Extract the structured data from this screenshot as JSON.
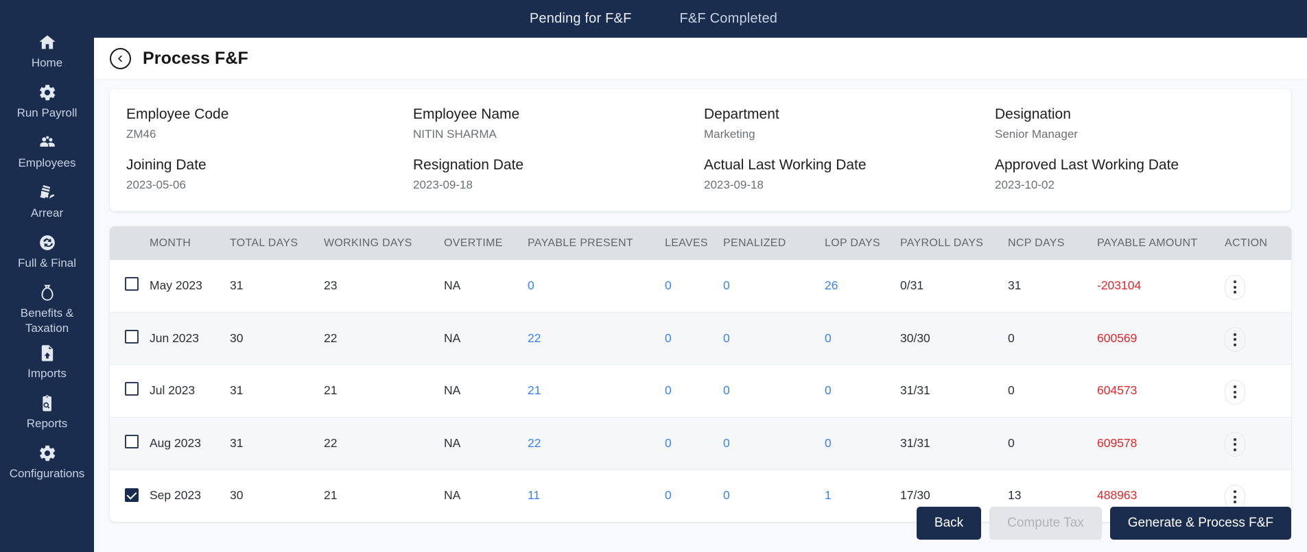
{
  "topbar": {
    "tabs": [
      {
        "label": "Pending for F&F",
        "active": true
      },
      {
        "label": "F&F Completed",
        "active": false
      }
    ]
  },
  "sidebar": {
    "items": [
      {
        "label": "Home",
        "icon": "home-icon"
      },
      {
        "label": "Run Payroll",
        "icon": "gear-icon"
      },
      {
        "label": "Employees",
        "icon": "people-icon"
      },
      {
        "label": "Arrear",
        "icon": "money-hand-icon"
      },
      {
        "label": "Full & Final",
        "icon": "refresh-circle-icon"
      },
      {
        "label": "Benefits &\nTaxation",
        "icon": "money-bag-icon"
      },
      {
        "label": "Imports",
        "icon": "file-upload-icon"
      },
      {
        "label": "Reports",
        "icon": "clipboard-search-icon"
      },
      {
        "label": "Configurations",
        "icon": "gear-icon"
      }
    ],
    "active_label": "Full & Final"
  },
  "header": {
    "title": "Process F&F",
    "back_icon": "back-arrow-circle-icon"
  },
  "employee": {
    "fields": [
      {
        "label": "Employee Code",
        "value": "ZM46"
      },
      {
        "label": "Employee Name",
        "value": "NITIN SHARMA"
      },
      {
        "label": "Department",
        "value": "Marketing"
      },
      {
        "label": "Designation",
        "value": "Senior Manager"
      },
      {
        "label": "Joining Date",
        "value": "2023-05-06"
      },
      {
        "label": "Resignation Date",
        "value": "2023-09-18"
      },
      {
        "label": "Actual Last Working Date",
        "value": "2023-09-18"
      },
      {
        "label": "Approved Last Working Date",
        "value": "2023-10-02"
      }
    ]
  },
  "table": {
    "columns": [
      "MONTH",
      "TOTAL DAYS",
      "WORKING DAYS",
      "OVERTIME",
      "PAYABLE PRESENT",
      "LEAVES",
      "PENALIZED",
      "LOP DAYS",
      "PAYROLL DAYS",
      "NCP DAYS",
      "PAYABLE AMOUNT",
      "ACTION"
    ],
    "rows": [
      {
        "selected": false,
        "month": "May 2023",
        "total_days": "31",
        "working_days": "23",
        "overtime": "NA",
        "payable_present": "0",
        "leaves": "0",
        "penalized": "0",
        "lop_days": "26",
        "payroll_days": "0/31",
        "ncp_days": "31",
        "payable_amount": "-203104"
      },
      {
        "selected": false,
        "month": "Jun 2023",
        "total_days": "30",
        "working_days": "22",
        "overtime": "NA",
        "payable_present": "22",
        "leaves": "0",
        "penalized": "0",
        "lop_days": "0",
        "payroll_days": "30/30",
        "ncp_days": "0",
        "payable_amount": "600569"
      },
      {
        "selected": false,
        "month": "Jul 2023",
        "total_days": "31",
        "working_days": "21",
        "overtime": "NA",
        "payable_present": "21",
        "leaves": "0",
        "penalized": "0",
        "lop_days": "0",
        "payroll_days": "31/31",
        "ncp_days": "0",
        "payable_amount": "604573"
      },
      {
        "selected": false,
        "month": "Aug 2023",
        "total_days": "31",
        "working_days": "22",
        "overtime": "NA",
        "payable_present": "22",
        "leaves": "0",
        "penalized": "0",
        "lop_days": "0",
        "payroll_days": "31/31",
        "ncp_days": "0",
        "payable_amount": "609578"
      },
      {
        "selected": true,
        "month": "Sep 2023",
        "total_days": "30",
        "working_days": "21",
        "overtime": "NA",
        "payable_present": "11",
        "leaves": "0",
        "penalized": "0",
        "lop_days": "1",
        "payroll_days": "17/30",
        "ncp_days": "13",
        "payable_amount": "488963"
      }
    ]
  },
  "footer": {
    "back_label": "Back",
    "compute_tax_label": "Compute Tax",
    "generate_label": "Generate & Process F&F"
  },
  "colors": {
    "brand_navy": "#1b2d4f",
    "link_blue": "#3b82f6",
    "amount_red": "#e8262a",
    "header_grey": "#dde1e6"
  }
}
